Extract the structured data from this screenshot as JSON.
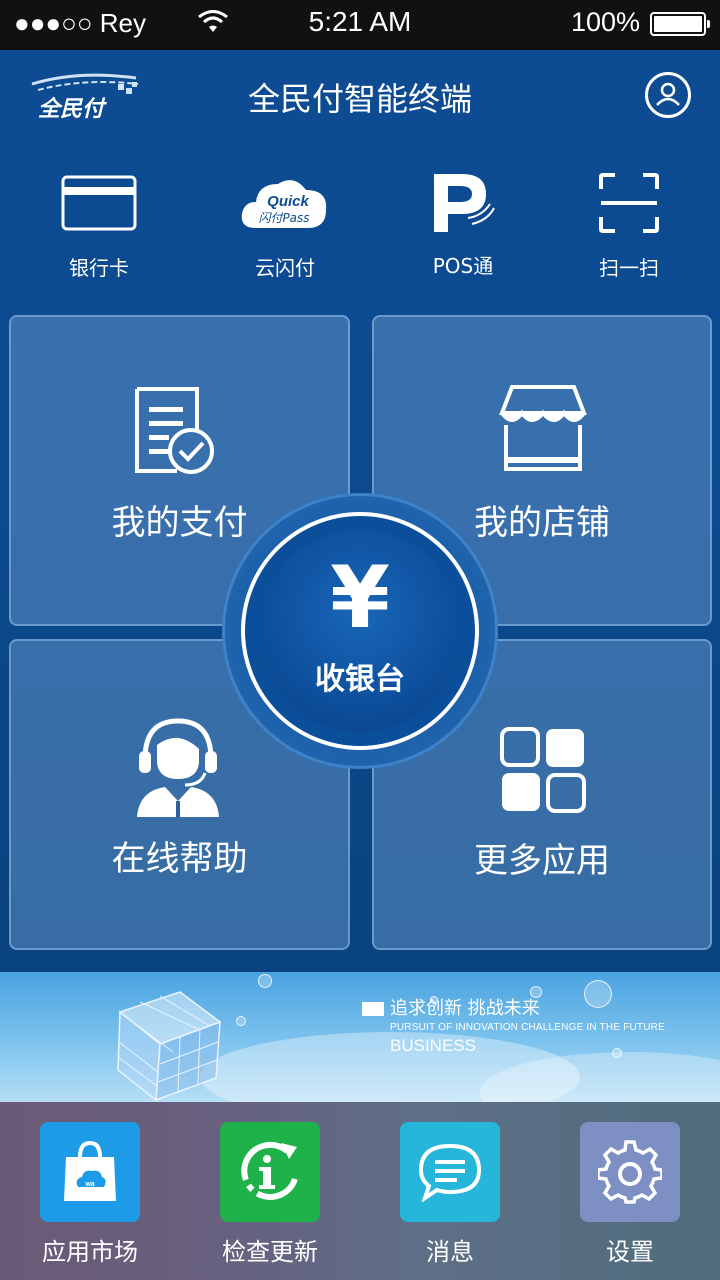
{
  "status_bar": {
    "carrier": "●●●○○ Rey",
    "time": "5:21 AM",
    "battery": "100%"
  },
  "header": {
    "logo_text": "全民付",
    "title": "全民付智能终端",
    "user_icon": "user-icon"
  },
  "quick_actions": [
    {
      "label": "银行卡",
      "icon": "bank-card-icon"
    },
    {
      "label": "云闪付",
      "icon": "quickpass-icon",
      "badge_line1": "Quick",
      "badge_line2": "闪付Pass"
    },
    {
      "label": "POS通",
      "icon": "pos-icon"
    },
    {
      "label": "扫一扫",
      "icon": "scan-icon"
    }
  ],
  "tiles": {
    "my_payment": {
      "label": "我的支付",
      "icon": "payment-doc-icon"
    },
    "my_store": {
      "label": "我的店铺",
      "icon": "store-icon"
    },
    "online_help": {
      "label": "在线帮助",
      "icon": "support-agent-icon"
    },
    "more_apps": {
      "label": "更多应用",
      "icon": "apps-grid-icon"
    }
  },
  "cashier": {
    "symbol": "¥",
    "label": "收银台"
  },
  "banner": {
    "title_cn": "追求创新 挑战未来",
    "subtitle_en": "PURSUIT OF INNOVATION CHALLENGE IN THE FUTURE",
    "subtitle_en2": "BUSINESS"
  },
  "dock": [
    {
      "label": "应用市场",
      "icon": "app-market-icon",
      "color": "#1e9be6"
    },
    {
      "label": "检查更新",
      "icon": "check-update-icon",
      "color": "#1fb24a"
    },
    {
      "label": "消息",
      "icon": "message-icon",
      "color": "#25b6d9"
    },
    {
      "label": "设置",
      "icon": "settings-icon",
      "color": "#7d8fc3"
    }
  ]
}
